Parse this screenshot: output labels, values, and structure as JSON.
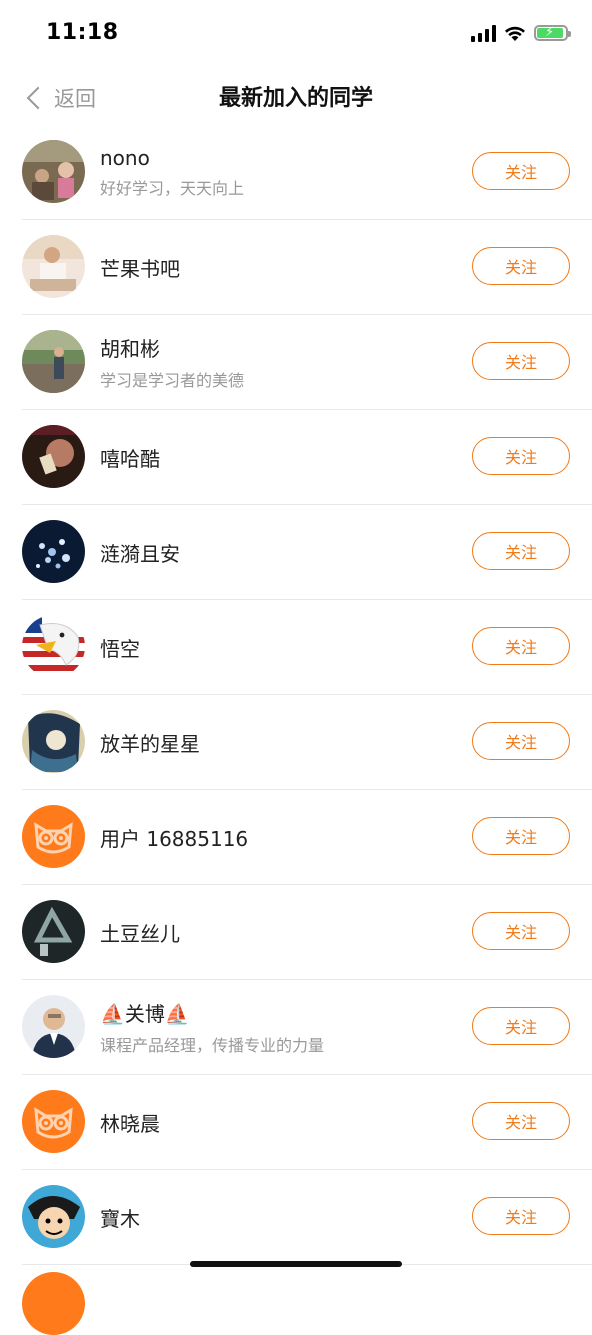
{
  "status": {
    "time": "11:18"
  },
  "nav": {
    "back_label": "返回",
    "title": "最新加入的同学"
  },
  "colors": {
    "accent": "#f07b1a",
    "owl_bg": "#ff7a1a"
  },
  "users": [
    {
      "name": "nono",
      "bio": "好好学习，天天向上",
      "follow_label": "关注",
      "avatar": "photo-family"
    },
    {
      "name": "芒果书吧",
      "bio": "",
      "follow_label": "关注",
      "avatar": "photo-person"
    },
    {
      "name": "胡和彬",
      "bio": "学习是学习者的美德",
      "follow_label": "关注",
      "avatar": "photo-outdoor"
    },
    {
      "name": "嘻哈酷",
      "bio": "",
      "follow_label": "关注",
      "avatar": "photo-dark"
    },
    {
      "name": "涟漪且安",
      "bio": "",
      "follow_label": "关注",
      "avatar": "photo-night"
    },
    {
      "name": "悟空",
      "bio": "",
      "follow_label": "关注",
      "avatar": "photo-eagle"
    },
    {
      "name": "放羊的星星",
      "bio": "",
      "follow_label": "关注",
      "avatar": "photo-anime"
    },
    {
      "name": "用户 16885116",
      "bio": "",
      "follow_label": "关注",
      "avatar": "owl-default"
    },
    {
      "name": "土豆丝儿",
      "bio": "",
      "follow_label": "关注",
      "avatar": "photo-triangle"
    },
    {
      "name": "⛵关博⛵",
      "bio": "课程产品经理，传播专业的力量",
      "follow_label": "关注",
      "avatar": "photo-man"
    },
    {
      "name": "林晓晨",
      "bio": "",
      "follow_label": "关注",
      "avatar": "owl-default"
    },
    {
      "name": "寶木",
      "bio": "",
      "follow_label": "关注",
      "avatar": "photo-cartoon"
    }
  ]
}
